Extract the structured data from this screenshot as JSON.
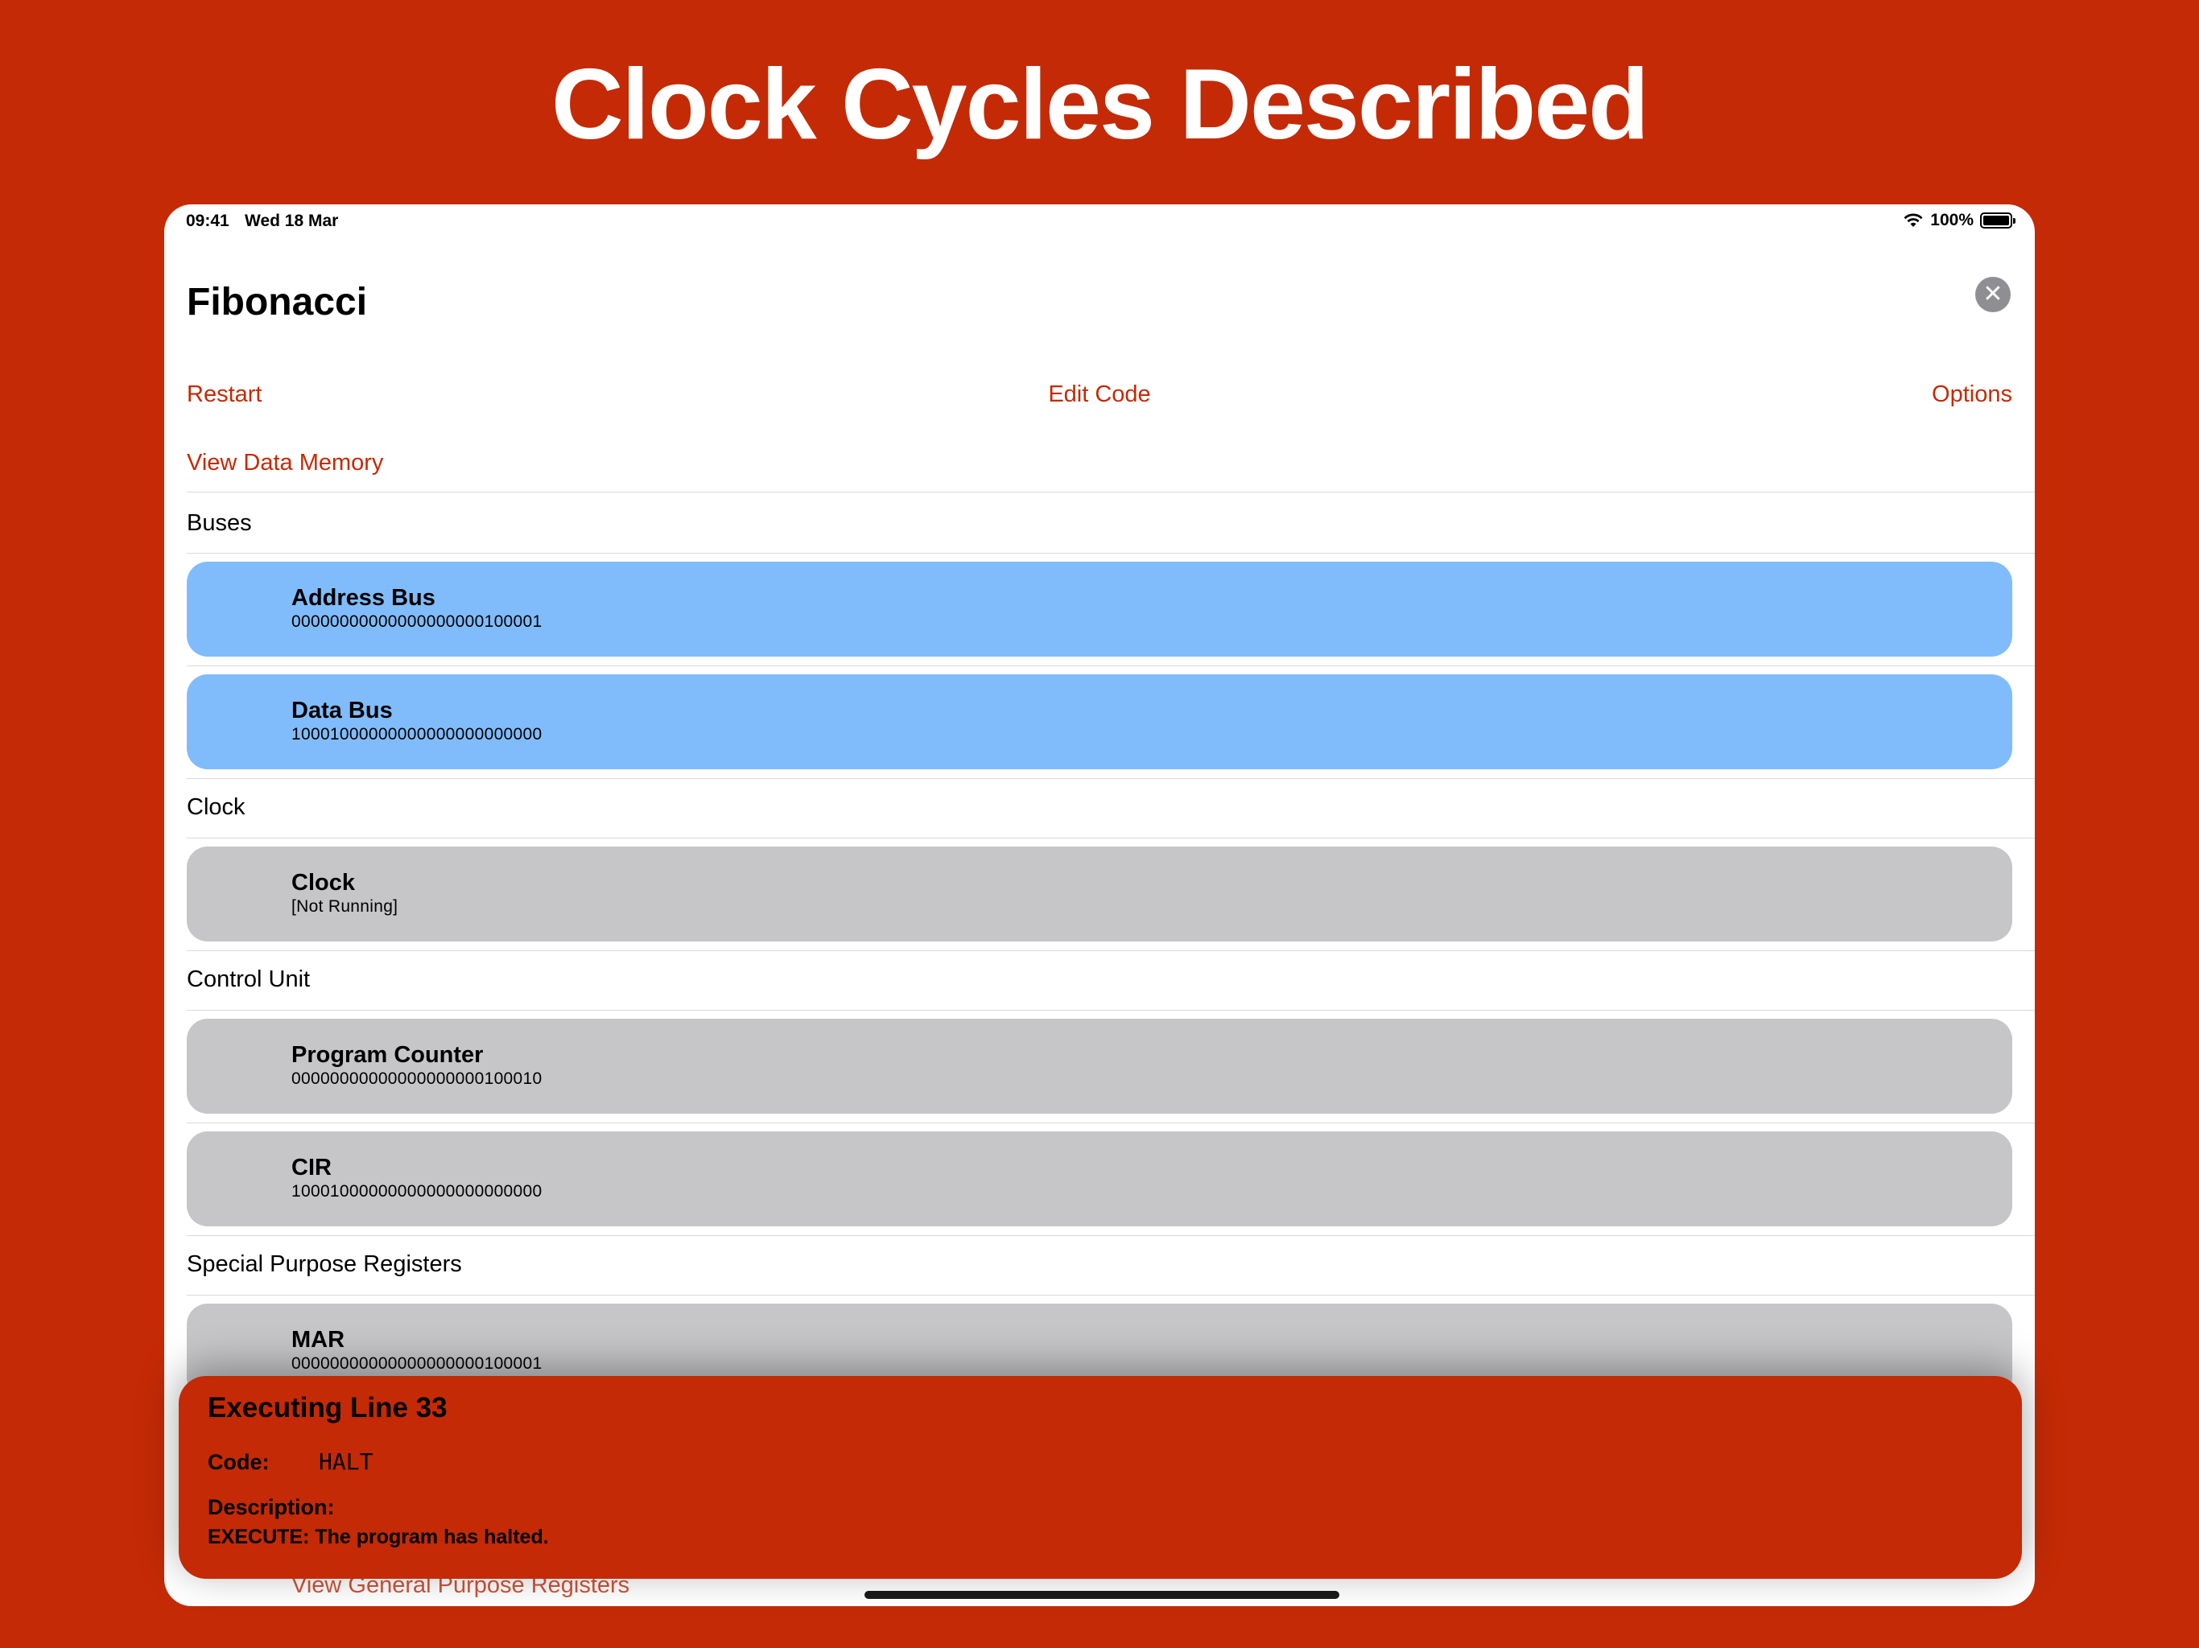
{
  "headline": "Clock Cycles Described",
  "status_bar": {
    "time": "09:41",
    "date": "Wed 18 Mar",
    "battery": "100%",
    "icons": [
      "wifi-icon",
      "battery-icon"
    ]
  },
  "header": {
    "title": "Fibonacci",
    "close_icon": "close-icon"
  },
  "toolbar": {
    "restart_label": "Restart",
    "edit_label": "Edit Code",
    "options_label": "Options",
    "view_data_label": "View Data Memory"
  },
  "sections": {
    "buses": {
      "header": "Buses",
      "items": [
        {
          "title": "Address Bus",
          "value": "00000000000000000000100001"
        },
        {
          "title": "Data Bus",
          "value": "10001000000000000000000000"
        }
      ]
    },
    "clock": {
      "header": "Clock",
      "items": [
        {
          "title": "Clock",
          "value": "[Not Running]"
        }
      ]
    },
    "control_unit": {
      "header": "Control Unit",
      "items": [
        {
          "title": "Program Counter",
          "value": "00000000000000000000100010"
        },
        {
          "title": "CIR",
          "value": "10001000000000000000000000"
        }
      ]
    },
    "special_purpose": {
      "header": "Special Purpose Registers",
      "items": [
        {
          "title": "MAR",
          "value": "00000000000000000000100001"
        }
      ]
    }
  },
  "footer": {
    "gpr_link": "View General Purpose Registers"
  },
  "exec_panel": {
    "title": "Executing Line 33",
    "code_label": "Code:",
    "code_value": "HALT",
    "description_label": "Description:",
    "description_value": "EXECUTE: The program has halted."
  },
  "colors": {
    "accent": "#C42A06",
    "bus_card": "#80BCFB",
    "register_card": "#C6C6C9"
  }
}
